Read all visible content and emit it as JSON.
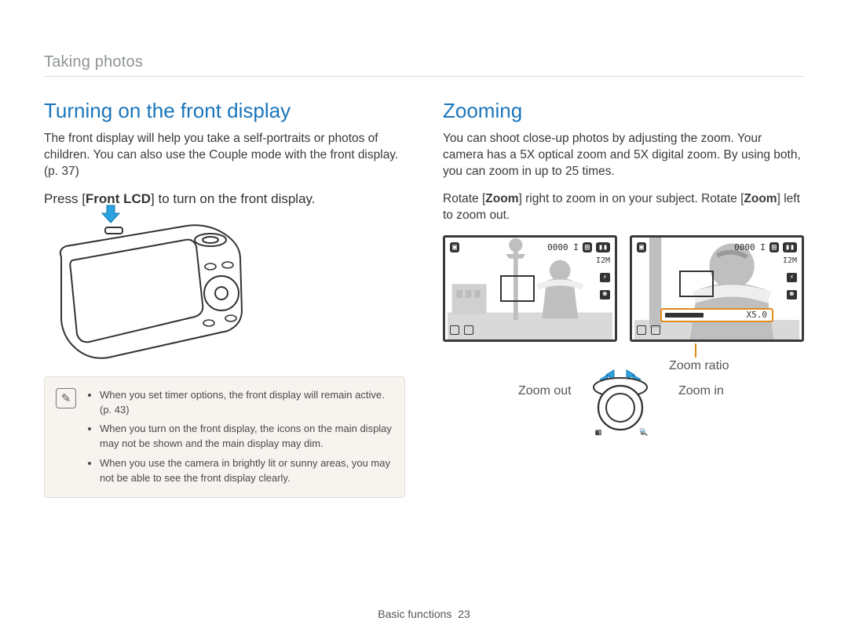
{
  "breadcrumb": "Taking photos",
  "left": {
    "heading": "Turning on the front display",
    "intro": "The front display will help you take a self-portraits or photos of children. You can also use the Couple mode with the front display. (p. 37)",
    "instruction_pre": "Press ",
    "instruction_key_open": "[",
    "instruction_key_bold": "Front LCD",
    "instruction_key_close": "]",
    "instruction_post": " to turn on the front display.",
    "note_icon_glyph": "✎",
    "notes": {
      "n1": "When you set timer options, the front display will remain active. (p. 43)",
      "n2": "When you turn on the front display, the icons on the main display may not be shown and the main display may dim.",
      "n3": "When you use the camera in brightly lit or sunny areas, you may not be able to see the front display clearly."
    }
  },
  "right": {
    "heading": "Zooming",
    "intro": "You can shoot close-up photos by adjusting the zoom. Your camera has a 5X optical zoom and 5X digital zoom. By using both, you can zoom in up to 25 times.",
    "instr_pre": "Rotate ",
    "instr_b1_open": "[",
    "instr_b1_bold": "Zoom",
    "instr_b1_close": "]",
    "instr_mid": " right to zoom in on your subject. Rotate ",
    "instr_b2_open": "[",
    "instr_b2_bold": "Zoom",
    "instr_b2_close": "]",
    "instr_post": " left to zoom out.",
    "hud": {
      "counter": "0000 I",
      "res": "I2M",
      "zoom_label": "X5.0"
    },
    "labels": {
      "ratio": "Zoom ratio",
      "out": "Zoom out",
      "in": "Zoom in"
    }
  },
  "footer": {
    "section": "Basic functions",
    "page": "23"
  },
  "colors": {
    "accent": "#1a75bb",
    "arrow": "#2aa3e0",
    "zoom_outline": "#e28a1a"
  }
}
